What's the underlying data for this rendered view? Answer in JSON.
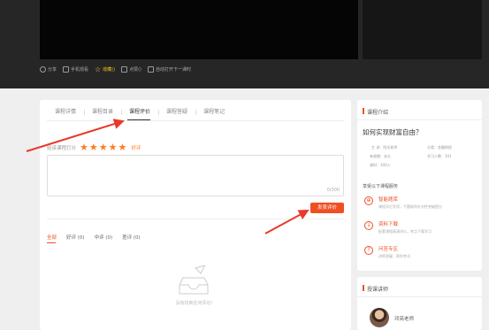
{
  "actions": [
    {
      "icon": "share-icon",
      "label": "分享"
    },
    {
      "icon": "phone-icon",
      "label": "手机观看"
    },
    {
      "icon": "star-icon",
      "label": "收藏()"
    },
    {
      "icon": "thumbs-up-icon",
      "label": "点赞()"
    },
    {
      "icon": "autoplay-icon",
      "label": "自动打开下一课时"
    }
  ],
  "tabs": [
    "课程详情",
    "课程目录",
    "课程评价",
    "课程答疑",
    "课程笔记"
  ],
  "active_tab": "课程评价",
  "rating": {
    "label": "给该课程打分",
    "stars": 5,
    "text": "好评"
  },
  "comment": {
    "counter": "0/300"
  },
  "submit_label": "发表评价",
  "filters": [
    "全部",
    "好评 (0)",
    "中评 (0)",
    "差评 (0)"
  ],
  "empty_text": "没有找到任何评论！",
  "intro": {
    "header": "课程介绍",
    "title": "如何实现财富自由？",
    "info": {
      "subject": "主 讲：阳光老师",
      "category": "分类：金融财经",
      "validity": "有效期：永久",
      "learners": "学习人数：101",
      "hours": "课时：100人"
    },
    "services_header": "享受以下课程服务",
    "services": [
      {
        "icon": "smart-bank-icon",
        "title": "智能题库",
        "desc": "课程学后专项，千题助你针对性突破提分"
      },
      {
        "icon": "download-icon",
        "title": "资料下载",
        "desc": "配套课程高清讲义，考点下载学习"
      },
      {
        "icon": "question-icon",
        "title": "问答专区",
        "desc": "讲师答疑，帮你考试"
      }
    ]
  },
  "teachers": {
    "header": "授课讲师",
    "name": "邓亮老师"
  },
  "colors": {
    "accent": "#f04f24",
    "star": "#ff7a25",
    "arrow": "#e8392b"
  }
}
